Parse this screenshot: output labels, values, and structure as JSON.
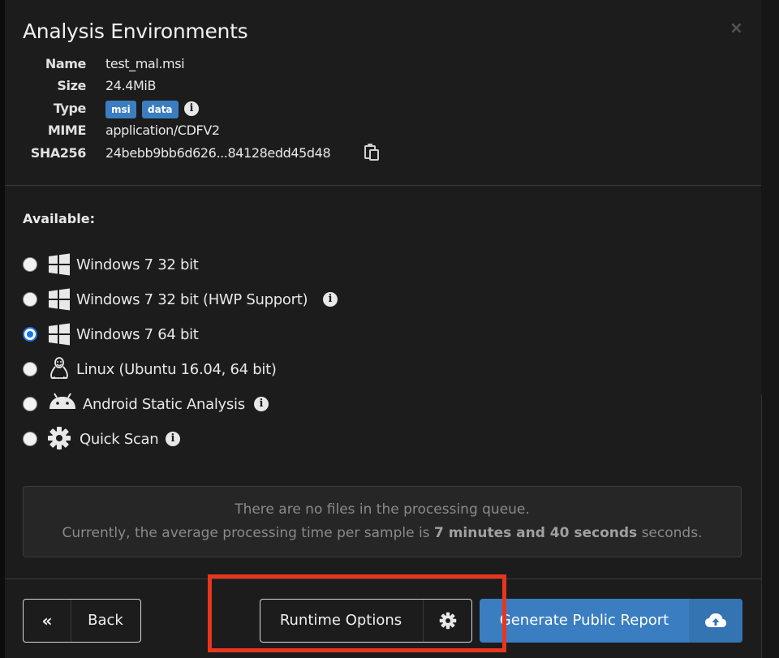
{
  "modal": {
    "title": "Analysis Environments",
    "close_label": "×"
  },
  "file_info": {
    "name_key": "Name",
    "name_value": "test_mal.msi",
    "size_key": "Size",
    "size_value": "24.4MiB",
    "type_key": "Type",
    "type_badges": [
      "msi",
      "data"
    ],
    "mime_key": "MIME",
    "mime_value": "application/CDFV2",
    "sha_key": "SHA256",
    "sha_value": "24bebb9bb6d626...84128edd45d48"
  },
  "environments": {
    "label": "Available:",
    "items": [
      {
        "label": "Windows 7 32 bit",
        "icon": "windows-icon",
        "checked": false,
        "info": false
      },
      {
        "label": "Windows 7 32 bit (HWP Support)",
        "icon": "windows-icon",
        "checked": false,
        "info": true
      },
      {
        "label": "Windows 7 64 bit",
        "icon": "windows-icon",
        "checked": true,
        "info": false
      },
      {
        "label": "Linux (Ubuntu 16.04, 64 bit)",
        "icon": "linux-icon",
        "checked": false,
        "info": false
      },
      {
        "label": "Android Static Analysis",
        "icon": "android-icon",
        "checked": false,
        "info": true
      },
      {
        "label": "Quick Scan",
        "icon": "gear-icon",
        "checked": false,
        "info": true
      }
    ]
  },
  "queue": {
    "line1": "There are no files in the processing queue.",
    "line2_prefix": "Currently, the average processing time per sample is ",
    "line2_bold": "7 minutes and 40 seconds",
    "line2_suffix": " seconds."
  },
  "footer": {
    "back_icon": "«",
    "back_label": "Back",
    "runtime_label": "Runtime Options",
    "generate_label": "Generate Public Report"
  },
  "colors": {
    "accent": "#3a7ec1",
    "highlight": "#e8361e",
    "modal_bg": "#1c1c1c"
  },
  "info_glyph": "i"
}
